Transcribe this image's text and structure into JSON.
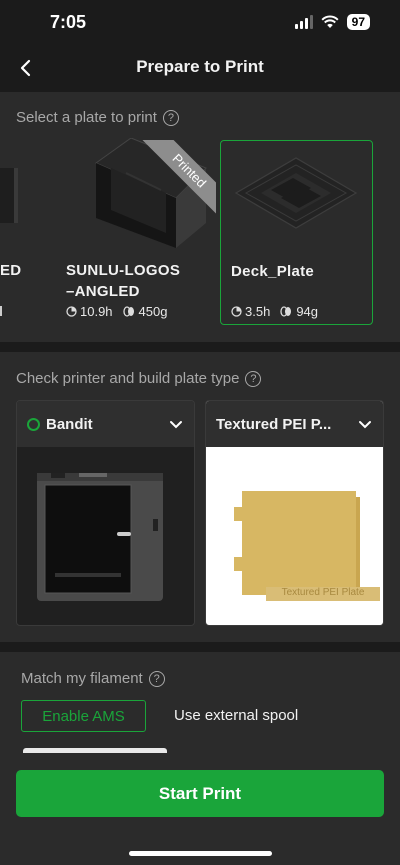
{
  "status_bar": {
    "time": "7:05",
    "battery": "97"
  },
  "header": {
    "title": "Prepare to Print"
  },
  "plates_section": {
    "title": "Select a plate to print",
    "plates": [
      {
        "name_line1": "ED",
        "name_line2": "",
        "time": "",
        "weight": ""
      },
      {
        "name_line1": "SUNLU-LOGOS",
        "name_line2": "–ANGLED",
        "time": "10.9h",
        "weight": "450g",
        "badge": "Printed"
      },
      {
        "name_line1": "Deck_Plate",
        "name_line2": "",
        "time": "3.5h",
        "weight": "94g",
        "selected": true
      }
    ]
  },
  "printer_section": {
    "title": "Check printer and build plate type",
    "printer_name": "Bandit",
    "plate_type": "Textured PEI P...",
    "plate_image_label": "Textured PEI Plate"
  },
  "filament_section": {
    "title": "Match my filament",
    "enable_ams": "Enable AMS",
    "external_spool": "Use external spool"
  },
  "start_print": "Start Print",
  "colors": {
    "accent": "#1aa53a",
    "panel": "#2b2b2b",
    "background": "#1b1b1b"
  }
}
